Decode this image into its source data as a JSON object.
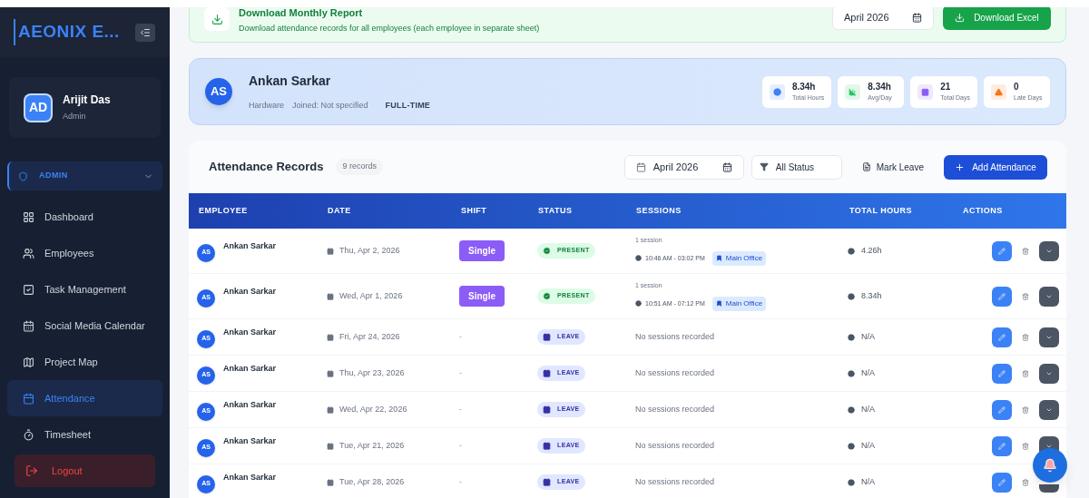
{
  "sidebar": {
    "brand": "AEONIX E...",
    "user": {
      "initials": "AD",
      "name": "Arijit Das",
      "role": "Admin"
    },
    "group": {
      "label": "ADMIN",
      "expanded": true
    },
    "items": [
      {
        "label": "Dashboard",
        "selected": false
      },
      {
        "label": "Employees",
        "selected": false
      },
      {
        "label": "Task Management",
        "selected": false
      },
      {
        "label": "Social Media Calendar",
        "selected": false
      },
      {
        "label": "Project Map",
        "selected": false
      },
      {
        "label": "Attendance",
        "selected": true
      },
      {
        "label": "Timesheet",
        "selected": false
      }
    ],
    "logout": "Logout"
  },
  "report": {
    "title": "Download Monthly Report",
    "description": "Download attendance records for all employees (each employee in separate sheet)",
    "month": "April 2026",
    "button": "Download Excel"
  },
  "profile": {
    "initials": "AS",
    "name": "Ankan Sarkar",
    "department": "Hardware",
    "joined": "Joined: Not specified",
    "type": "FULL-TIME",
    "stats": [
      {
        "value": "8.34h",
        "label": "Total Hours",
        "color": "#3b82f6"
      },
      {
        "value": "8.34h",
        "label": "Avg/Day",
        "color": "#22c55e"
      },
      {
        "value": "21",
        "label": "Total Days",
        "color": "#8b5cf6"
      },
      {
        "value": "0",
        "label": "Late Days",
        "color": "#f97316"
      }
    ]
  },
  "records": {
    "title": "Attendance Records",
    "count": "9 records",
    "month": "April 2026",
    "status_filter": "All Status",
    "mark_leave": "Mark Leave",
    "add": "Add Attendance",
    "columns": [
      "EMPLOYEE",
      "DATE",
      "SHIFT",
      "STATUS",
      "SESSIONS",
      "TOTAL HOURS",
      "ACTIONS"
    ],
    "rows": [
      {
        "initials": "AS",
        "name": "Ankan Sarkar",
        "date": "Thu, Apr 2, 2026",
        "shift": {
          "kind": "badge",
          "label": "Single"
        },
        "status": {
          "kind": "present",
          "label": "PRESENT"
        },
        "sessions": {
          "kind": "list",
          "count": "1 session",
          "time": "10:46 AM - 03:02 PM",
          "location": "Main Office"
        },
        "hours": "4.26h"
      },
      {
        "initials": "AS",
        "name": "Ankan Sarkar",
        "date": "Wed, Apr 1, 2026",
        "shift": {
          "kind": "badge",
          "label": "Single"
        },
        "status": {
          "kind": "present",
          "label": "PRESENT"
        },
        "sessions": {
          "kind": "list",
          "count": "1 session",
          "time": "10:51 AM - 07:12 PM",
          "location": "Main Office"
        },
        "hours": "8.34h"
      },
      {
        "initials": "AS",
        "name": "Ankan Sarkar",
        "date": "Fri, Apr 24, 2026",
        "shift": {
          "kind": "none",
          "label": "-"
        },
        "status": {
          "kind": "leave",
          "label": "LEAVE"
        },
        "sessions": {
          "kind": "empty",
          "text": "No sessions recorded"
        },
        "hours": "N/A"
      },
      {
        "initials": "AS",
        "name": "Ankan Sarkar",
        "date": "Thu, Apr 23, 2026",
        "shift": {
          "kind": "none",
          "label": "-"
        },
        "status": {
          "kind": "leave",
          "label": "LEAVE"
        },
        "sessions": {
          "kind": "empty",
          "text": "No sessions recorded"
        },
        "hours": "N/A"
      },
      {
        "initials": "AS",
        "name": "Ankan Sarkar",
        "date": "Wed, Apr 22, 2026",
        "shift": {
          "kind": "none",
          "label": "-"
        },
        "status": {
          "kind": "leave",
          "label": "LEAVE"
        },
        "sessions": {
          "kind": "empty",
          "text": "No sessions recorded"
        },
        "hours": "N/A"
      },
      {
        "initials": "AS",
        "name": "Ankan Sarkar",
        "date": "Tue, Apr 21, 2026",
        "shift": {
          "kind": "none",
          "label": "-"
        },
        "status": {
          "kind": "leave",
          "label": "LEAVE"
        },
        "sessions": {
          "kind": "empty",
          "text": "No sessions recorded"
        },
        "hours": "N/A"
      },
      {
        "initials": "AS",
        "name": "Ankan Sarkar",
        "date": "Tue, Apr 28, 2026",
        "shift": {
          "kind": "none",
          "label": "-"
        },
        "status": {
          "kind": "leave",
          "label": "LEAVE"
        },
        "sessions": {
          "kind": "empty",
          "text": "No sessions recorded"
        },
        "hours": "N/A"
      }
    ]
  }
}
